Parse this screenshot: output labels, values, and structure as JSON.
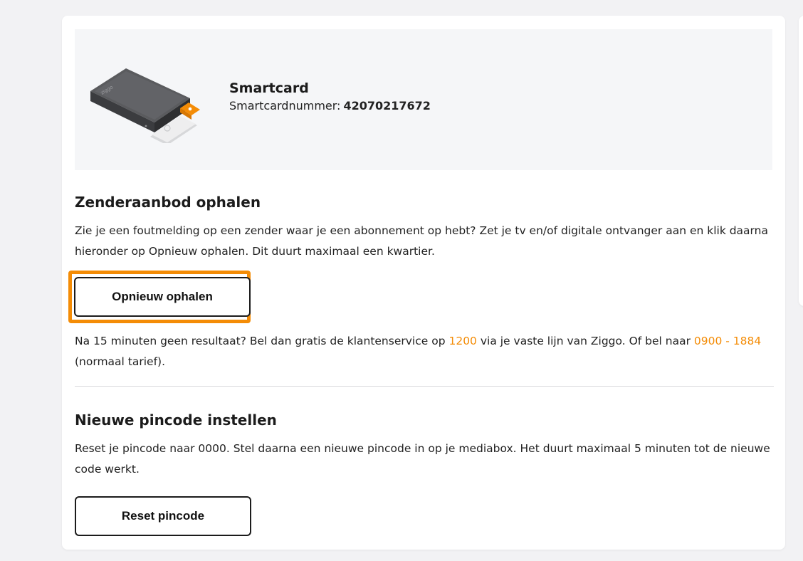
{
  "product": {
    "title": "Smartcard",
    "number_label": "Smartcardnummer:",
    "number_value": "42070217672",
    "card_icon_text": "ziggo",
    "box_brand_text": "ziggo"
  },
  "channels_section": {
    "title": "Zenderaanbod ophalen",
    "description": "Zie je een foutmelding op een zender waar je een abonnement op hebt? Zet je tv en/of digitale ontvanger aan en klik daarna hieronder op Opnieuw ophalen. Dit duurt maximaal een kwartier.",
    "button_label": "Opnieuw ophalen",
    "help_prefix": "Na 15 minuten geen resultaat? Bel dan gratis de klantenservice op ",
    "help_link1": "1200",
    "help_middle": " via je vaste lijn van Ziggo. Of bel naar ",
    "help_link2": "0900 - 1884",
    "help_suffix": " (normaal tarief)."
  },
  "pincode_section": {
    "title": "Nieuwe pincode instellen",
    "description": "Reset je pincode naar 0000. Stel daarna een nieuwe pincode in op je mediabox. Het duurt maximaal 5 minuten tot de nieuwe code werkt.",
    "button_label": "Reset pincode"
  },
  "colors": {
    "accent": "#f48c06",
    "text": "#1b1b1b",
    "panel_bg": "#f5f6f8",
    "page_bg": "#f2f2f4"
  }
}
